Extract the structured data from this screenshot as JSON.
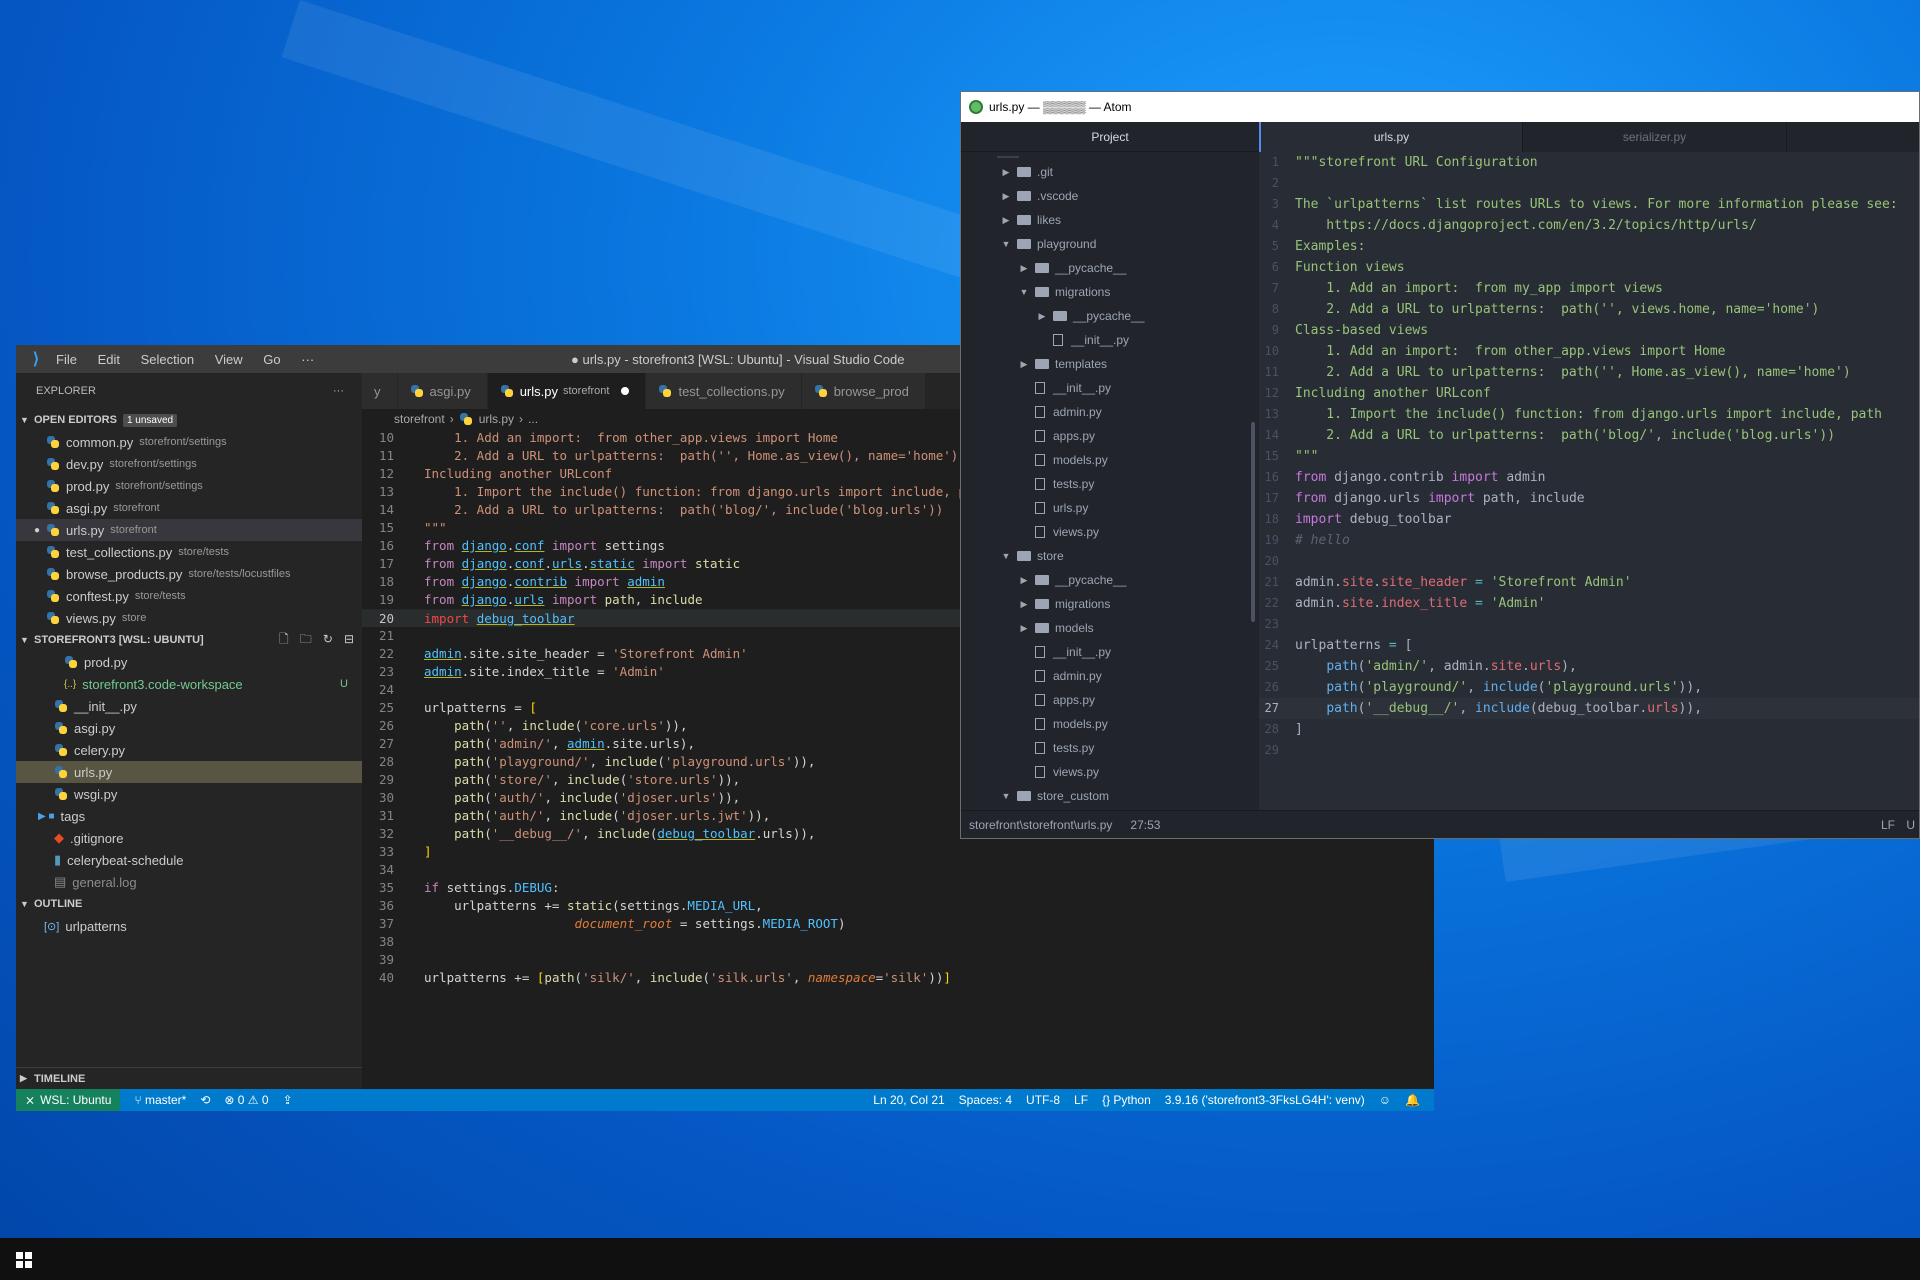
{
  "vscode": {
    "menu": [
      "File",
      "Edit",
      "Selection",
      "View",
      "Go",
      "···"
    ],
    "title": "● urls.py - storefront3 [WSL: Ubuntu] - Visual Studio Code",
    "explorer_label": "EXPLORER",
    "open_editors": {
      "label": "OPEN EDITORS",
      "badge": "1 unsaved",
      "items": [
        {
          "name": "common.py",
          "path": "storefront/settings"
        },
        {
          "name": "dev.py",
          "path": "storefront/settings"
        },
        {
          "name": "prod.py",
          "path": "storefront/settings"
        },
        {
          "name": "asgi.py",
          "path": "storefront"
        },
        {
          "name": "urls.py",
          "path": "storefront"
        },
        {
          "name": "test_collections.py",
          "path": "store/tests"
        },
        {
          "name": "browse_products.py",
          "path": "store/tests/locustfiles"
        },
        {
          "name": "conftest.py",
          "path": "store/tests"
        },
        {
          "name": "views.py",
          "path": "store"
        }
      ]
    },
    "workspace": {
      "label": "STOREFRONT3 [WSL: UBUNTU]",
      "items": [
        {
          "name": "prod.py",
          "badge": ""
        },
        {
          "name": "storefront3.code-workspace",
          "badge": "U"
        },
        {
          "name": "__init__.py",
          "badge": ""
        },
        {
          "name": "asgi.py",
          "badge": ""
        },
        {
          "name": "celery.py",
          "badge": ""
        },
        {
          "name": "urls.py",
          "badge": ""
        },
        {
          "name": "wsgi.py",
          "badge": ""
        },
        {
          "name": "tags",
          "badge": ""
        },
        {
          "name": ".gitignore",
          "badge": ""
        },
        {
          "name": "celerybeat-schedule",
          "badge": ""
        },
        {
          "name": "general.log",
          "badge": ""
        }
      ]
    },
    "outline": {
      "label": "OUTLINE",
      "items": [
        "urlpatterns"
      ]
    },
    "timeline_label": "TIMELINE",
    "tabs": [
      {
        "name": "y",
        "desc": ""
      },
      {
        "name": "asgi.py",
        "desc": ""
      },
      {
        "name": "urls.py",
        "desc": "storefront"
      },
      {
        "name": "test_collections.py",
        "desc": ""
      },
      {
        "name": "browse_prod",
        "desc": ""
      }
    ],
    "breadcrumb": [
      "storefront",
      "urls.py",
      "..."
    ],
    "status": {
      "remote": "WSL: Ubuntu",
      "branch": "master*",
      "problems": "⊗ 0 ⚠ 0",
      "position": "Ln 20, Col 21",
      "spaces": "Spaces: 4",
      "encoding": "UTF-8",
      "eol": "LF",
      "language": "Python",
      "interpreter": "3.9.16 ('storefront3-3FksLG4H': venv)"
    },
    "line_numbers": [
      "10",
      "11",
      "12",
      "13",
      "14",
      "15",
      "16",
      "17",
      "18",
      "19",
      "20",
      "21",
      "22",
      "23",
      "24",
      "25",
      "26",
      "27",
      "28",
      "29",
      "30",
      "31",
      "32",
      "33",
      "34",
      "35",
      "36",
      "37",
      "38",
      "39",
      "40"
    ]
  },
  "atom": {
    "title": "urls.py — ▒▒▒▒▒ — Atom",
    "project_label": "Project",
    "tree": [
      {
        "name": ".git",
        "type": "dir",
        "depth": 0,
        "open": false
      },
      {
        "name": ".vscode",
        "type": "dir",
        "depth": 0,
        "open": false
      },
      {
        "name": "likes",
        "type": "dir",
        "depth": 0,
        "open": false
      },
      {
        "name": "playground",
        "type": "dir",
        "depth": 0,
        "open": true
      },
      {
        "name": "__pycache__",
        "type": "dir",
        "depth": 1,
        "open": false
      },
      {
        "name": "migrations",
        "type": "dir",
        "depth": 1,
        "open": true
      },
      {
        "name": "__pycache__",
        "type": "dir",
        "depth": 2,
        "open": false
      },
      {
        "name": "__init__.py",
        "type": "file",
        "depth": 2
      },
      {
        "name": "templates",
        "type": "dir",
        "depth": 1,
        "open": false
      },
      {
        "name": "__init__.py",
        "type": "file",
        "depth": 1
      },
      {
        "name": "admin.py",
        "type": "file",
        "depth": 1
      },
      {
        "name": "apps.py",
        "type": "file",
        "depth": 1
      },
      {
        "name": "models.py",
        "type": "file",
        "depth": 1
      },
      {
        "name": "tests.py",
        "type": "file",
        "depth": 1
      },
      {
        "name": "urls.py",
        "type": "file",
        "depth": 1
      },
      {
        "name": "views.py",
        "type": "file",
        "depth": 1
      },
      {
        "name": "store",
        "type": "dir",
        "depth": 0,
        "open": true
      },
      {
        "name": "__pycache__",
        "type": "dir",
        "depth": 1,
        "open": false
      },
      {
        "name": "migrations",
        "type": "dir",
        "depth": 1,
        "open": false
      },
      {
        "name": "models",
        "type": "dir",
        "depth": 1,
        "open": false
      },
      {
        "name": "__init__.py",
        "type": "file",
        "depth": 1
      },
      {
        "name": "admin.py",
        "type": "file",
        "depth": 1
      },
      {
        "name": "apps.py",
        "type": "file",
        "depth": 1
      },
      {
        "name": "models.py",
        "type": "file",
        "depth": 1
      },
      {
        "name": "tests.py",
        "type": "file",
        "depth": 1
      },
      {
        "name": "views.py",
        "type": "file",
        "depth": 1
      },
      {
        "name": "store_custom",
        "type": "dir",
        "depth": 0,
        "open": true
      }
    ],
    "tabs": [
      "urls.py",
      "serializer.py"
    ],
    "line_numbers": [
      "1",
      "2",
      "3",
      "4",
      "5",
      "6",
      "7",
      "8",
      "9",
      "10",
      "11",
      "12",
      "13",
      "14",
      "15",
      "16",
      "17",
      "18",
      "19",
      "20",
      "21",
      "22",
      "23",
      "24",
      "25",
      "26",
      "27",
      "28",
      "29"
    ],
    "status": {
      "path": "storefront\\storefront\\urls.py",
      "cursor": "27:53",
      "eol": "LF",
      "encoding": "U"
    }
  },
  "colors": {
    "vscode_status": "#007acc",
    "remote": "#16825d",
    "atom_bg": "#282c34"
  }
}
